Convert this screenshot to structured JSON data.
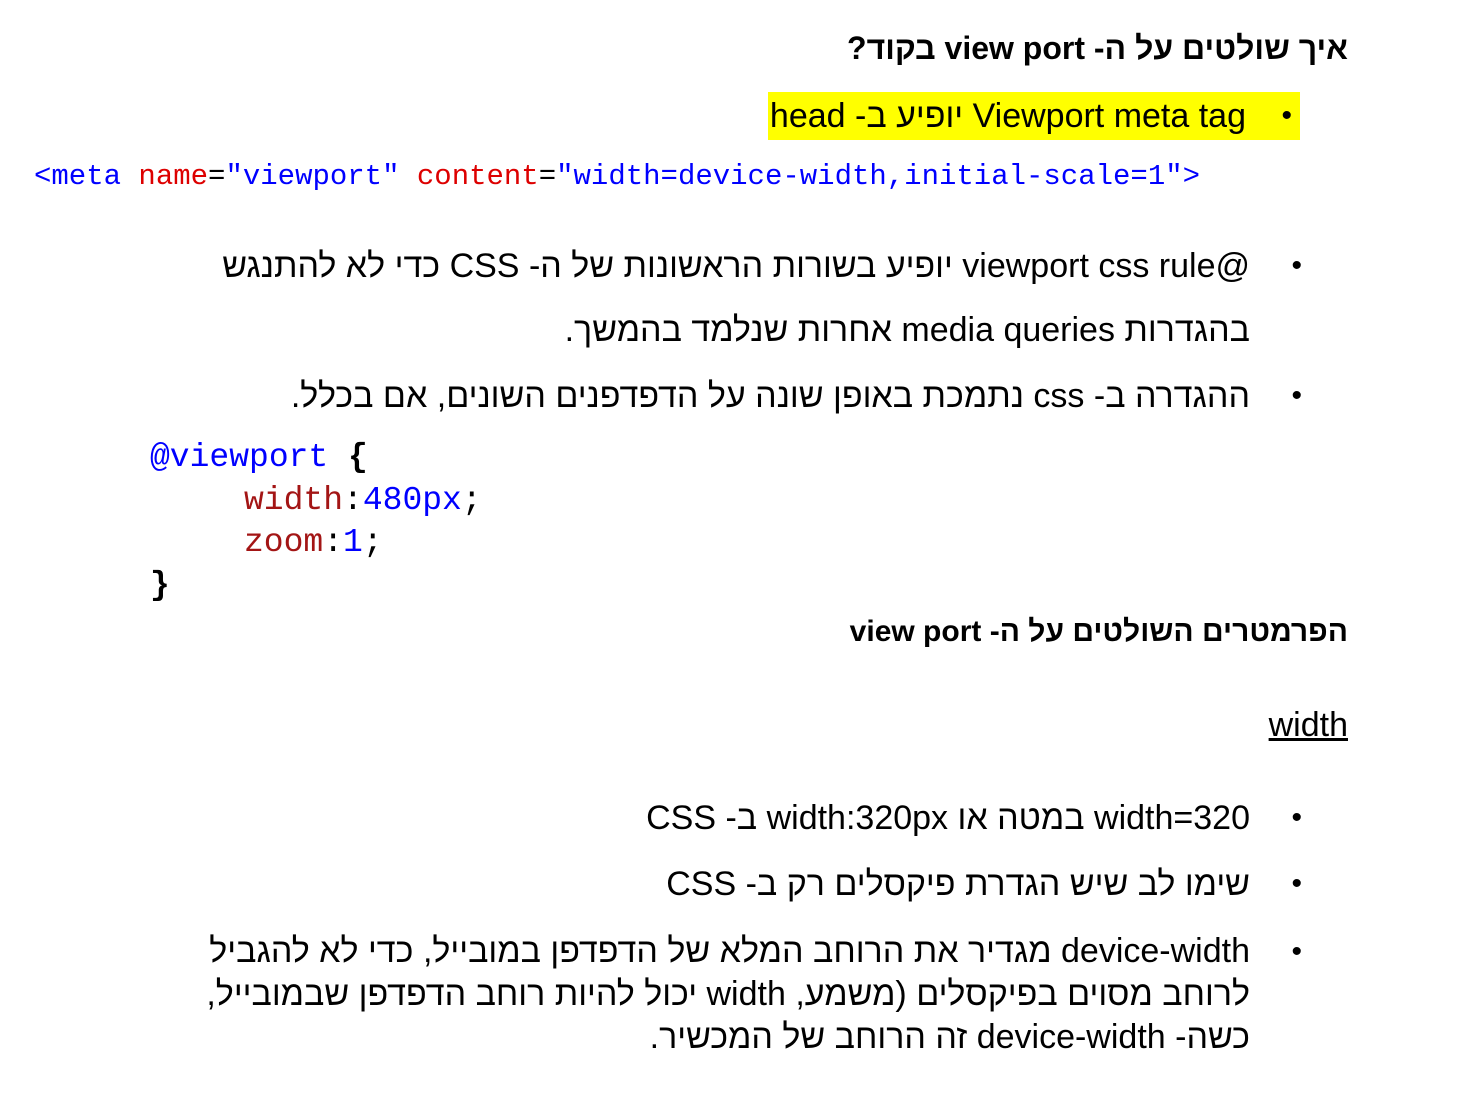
{
  "title": "איך שולטים על ה- view port בקוד?",
  "highlight_bullet": "Viewport meta tag יופיע ב- head",
  "meta_code": {
    "open": "<meta",
    "attr1": "name",
    "eq1": "=",
    "val1": "\"viewport\"",
    "attr2": "content",
    "eq2": "=",
    "val2": "\"width=device-width,initial-scale=1\"",
    "close": ">"
  },
  "bullets_css": [
    {
      "line1": "@viewport css rule יופיע בשורות הראשונות של ה- CSS כדי לא להתנגש",
      "line2": "בהגדרות media queries אחרות שנלמד בהמשך."
    },
    {
      "line1": "ההגדרה ב- css נתמכת באופן שונה על הדפדפנים השונים, אם בכלל."
    }
  ],
  "css_code": {
    "selector": "@viewport",
    "open_brace": "{",
    "prop1": "width",
    "val1": "480px",
    "prop2": "zoom",
    "val2": "1",
    "close_brace": "}"
  },
  "section_title": "הפרמטרים השולטים על ה- view port",
  "sub_title": "width",
  "bullets_width": [
    "width=320 במטה או width:320px ב- CSS",
    "שימו לב שיש הגדרת פיקסלים רק ב- CSS",
    "device-width מגדיר את הרוחב המלא של הדפדפן במובייל, כדי לא להגביל",
    "לרוחב מסוים בפיקסלים (משמע, width יכול להיות רוחב הדפדפן שבמובייל,",
    "כשה- device-width זה הרוחב של המכשיר."
  ],
  "bullet_symbol": "•"
}
